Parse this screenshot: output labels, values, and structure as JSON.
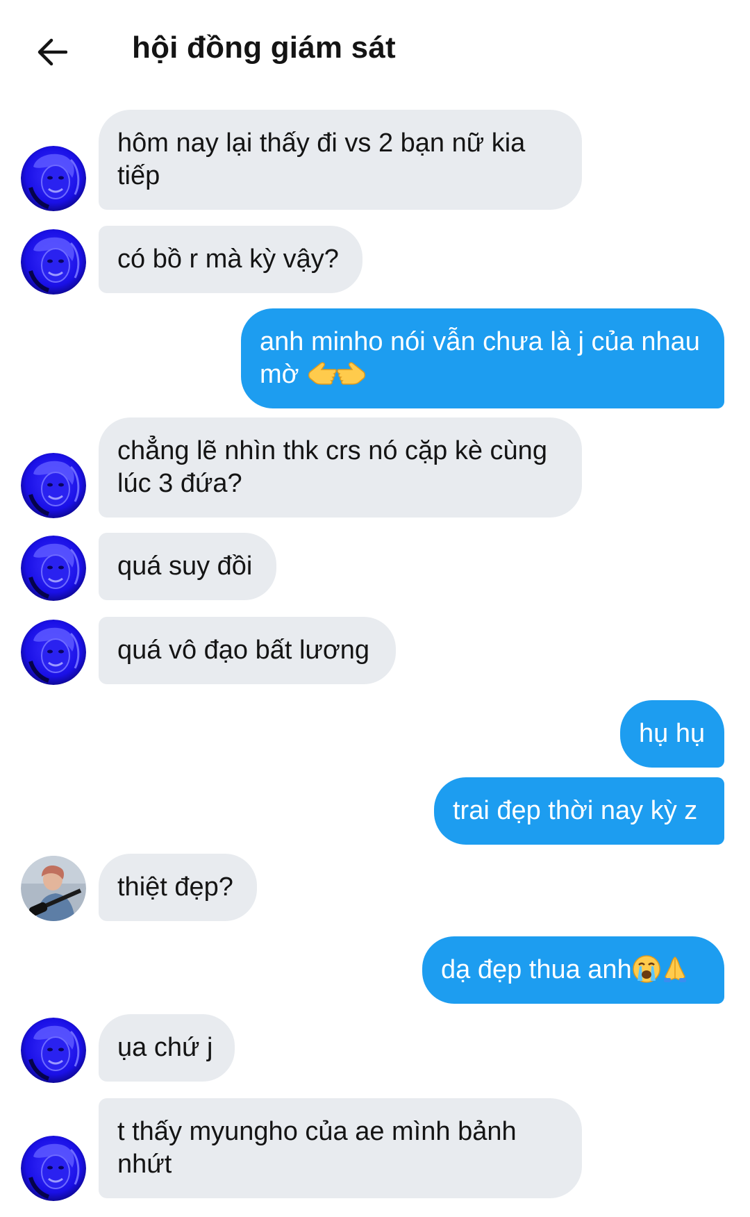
{
  "header": {
    "title": "hội đồng giám sát"
  },
  "messages": [
    {
      "side": "in",
      "text": "hôm nay lại thấy đi vs 2 bạn nữ kia tiếp",
      "avatar": "blue-portrait-avatar"
    },
    {
      "side": "in",
      "text": "có bồ r mà kỳ vậy?",
      "avatar": "blue-portrait-avatar"
    },
    {
      "side": "out",
      "text": "anh minho nói vẫn chưa là j của nhau mờ",
      "emoji": [
        "backhand-index-left-emoji",
        "backhand-index-right-emoji"
      ]
    },
    {
      "side": "in",
      "text": "chẳng lẽ nhìn thk crs nó cặp kè cùng lúc 3 đứa?",
      "avatar": "blue-portrait-avatar"
    },
    {
      "side": "in",
      "text": "quá suy đồi",
      "avatar": "blue-portrait-avatar"
    },
    {
      "side": "in",
      "text": "quá vô đạo bất lương",
      "avatar": "blue-portrait-avatar"
    },
    {
      "side": "out",
      "text": "hụ hụ"
    },
    {
      "side": "out",
      "text": "trai đẹp thời nay kỳ z"
    },
    {
      "side": "in",
      "text": "thiệt đẹp?",
      "avatar": "guitarist-photo-avatar"
    },
    {
      "side": "out",
      "text": "dạ đẹp thua anh",
      "emoji": [
        "loudly-crying-face-emoji",
        "folded-hands-emoji"
      ]
    },
    {
      "side": "in",
      "text": "ụa chứ j",
      "avatar": "blue-portrait-avatar"
    },
    {
      "side": "in",
      "text": "t thấy myungho của ae mình bảnh nhứt",
      "avatar": "blue-portrait-avatar"
    }
  ],
  "colors": {
    "incoming_bubble": "#e8ebef",
    "outgoing_bubble": "#1d9df0",
    "outgoing_text": "#ffffff",
    "avatar_blue": "#1a10e6"
  }
}
